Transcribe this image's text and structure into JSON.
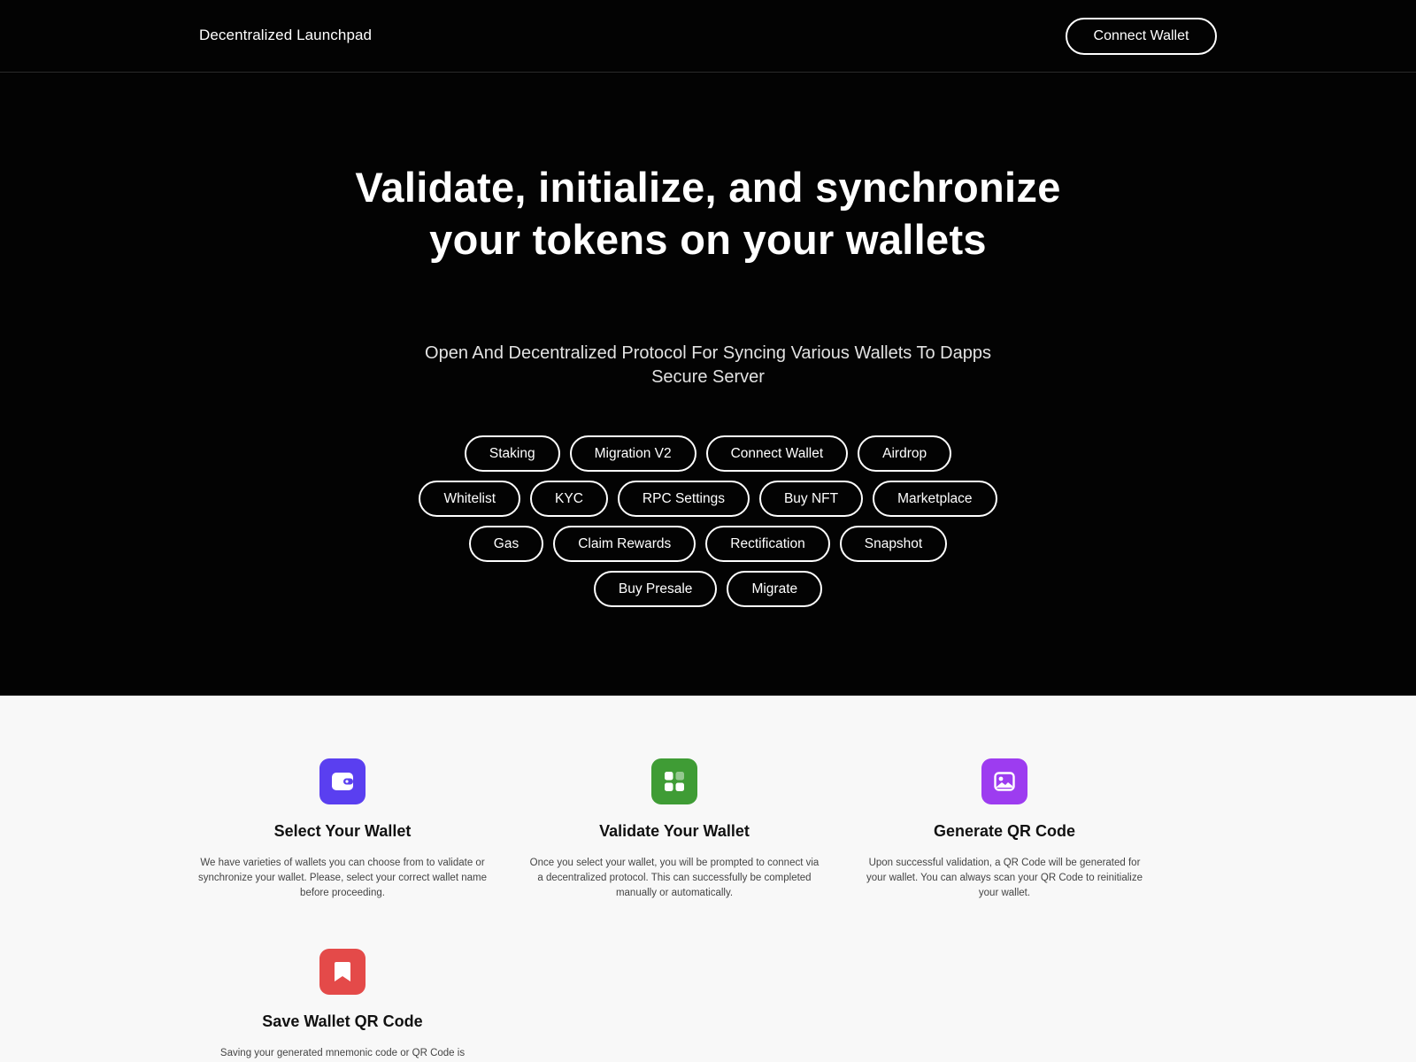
{
  "header": {
    "brand": "Decentralized Launchpad",
    "connect_label": "Connect Wallet"
  },
  "hero": {
    "title": "Validate, initialize, and synchronize your tokens on your wallets",
    "subtitle": "Open And Decentralized Protocol For Syncing Various Wallets To Dapps Secure Server",
    "pill_rows": [
      [
        "Staking",
        "Migration V2",
        "Connect Wallet",
        "Airdrop"
      ],
      [
        "Whitelist",
        "KYC",
        "RPC Settings",
        "Buy NFT",
        "Marketplace"
      ],
      [
        "Gas",
        "Claim Rewards",
        "Rectification",
        "Snapshot"
      ],
      [
        "Buy Presale",
        "Migrate"
      ]
    ]
  },
  "features": [
    {
      "icon": "wallet-icon",
      "color": "#5a3ff0",
      "title": "Select Your Wallet",
      "description": "We have varieties of wallets you can choose from to validate or synchronize your wallet. Please, select your correct wallet name before proceeding."
    },
    {
      "icon": "grid-icon",
      "color": "#3f9c35",
      "title": "Validate Your Wallet",
      "description": "Once you select your wallet, you will be prompted to connect via a decentralized protocol. This can successfully be completed manually or automatically."
    },
    {
      "icon": "image-icon",
      "color": "#9d3cf0",
      "title": "Generate QR Code",
      "description": "Upon successful validation, a QR Code will be generated for your wallet. You can always scan your QR Code to reinitialize your wallet."
    },
    {
      "icon": "bookmark-icon",
      "color": "#e44a49",
      "title": "Save Wallet QR Code",
      "description": "Saving your generated mnemonic code or QR Code is"
    }
  ]
}
